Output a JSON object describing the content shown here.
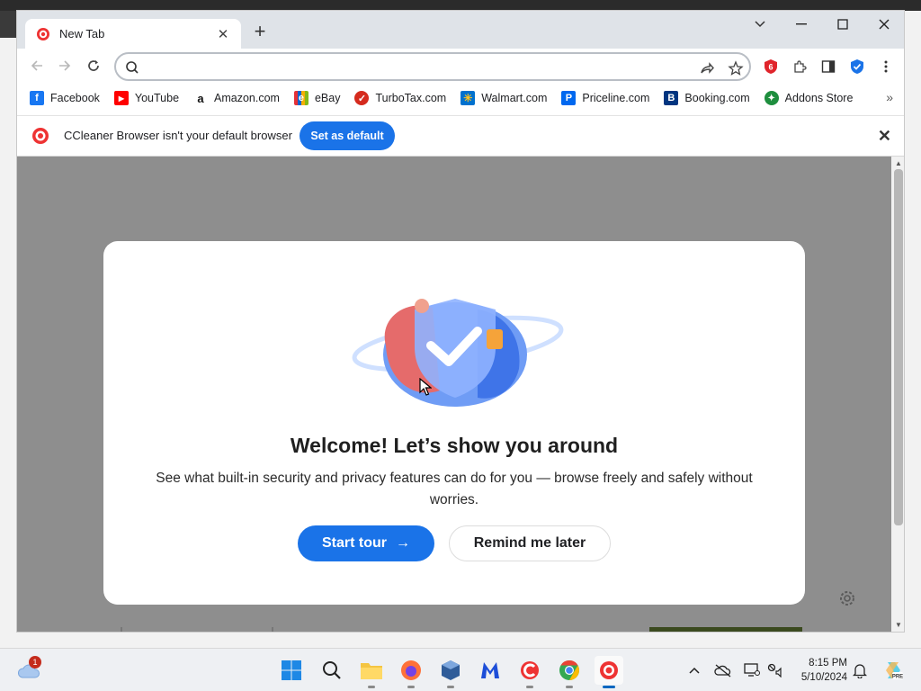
{
  "browser": {
    "tab_title": "New Tab",
    "new_tab_symbol": "+",
    "address_value": "",
    "bookmarks": [
      {
        "label": "Facebook",
        "icon": "facebook-icon",
        "color": "#1877f2",
        "glyph": "f"
      },
      {
        "label": "YouTube",
        "icon": "youtube-icon",
        "color": "#ff0000",
        "glyph": "▶"
      },
      {
        "label": "Amazon.com",
        "icon": "amazon-icon",
        "color": "#232f3e",
        "glyph": "a"
      },
      {
        "label": "eBay",
        "icon": "ebay-icon",
        "color": "#e53238",
        "glyph": "e"
      },
      {
        "label": "TurboTax.com",
        "icon": "turbotax-icon",
        "color": "#d52b1e",
        "glyph": "✓"
      },
      {
        "label": "Walmart.com",
        "icon": "walmart-icon",
        "color": "#0071ce",
        "glyph": "✳"
      },
      {
        "label": "Priceline.com",
        "icon": "priceline-icon",
        "color": "#0068ef",
        "glyph": "P"
      },
      {
        "label": "Booking.com",
        "icon": "booking-icon",
        "color": "#003580",
        "glyph": "B"
      },
      {
        "label": "Addons Store",
        "icon": "addons-store-icon",
        "color": "#1e8e3e",
        "glyph": "✦"
      }
    ],
    "infobar": {
      "text": "CCleaner Browser isn't your default browser",
      "button": "Set as default"
    }
  },
  "modal": {
    "title": "Welcome! Let’s show you around",
    "description": "See what built-in security and privacy features can do for you — browse freely and safely without worries.",
    "start_button": "Start tour",
    "start_arrow": "→",
    "remind_button": "Remind me later"
  },
  "taskbar": {
    "weather_badge": "1",
    "time": "8:15 PM",
    "date": "5/10/2024",
    "apps": [
      "start-icon",
      "search-icon",
      "file-explorer-icon",
      "firefox-icon",
      "virtualbox-icon",
      "malwarebytes-icon",
      "ccleaner-icon",
      "chrome-icon",
      "ccleaner-browser-icon"
    ]
  },
  "colors": {
    "accent": "#1a73e8",
    "page_overlay": "#8e8e8e",
    "titlebar": "#dfe3e8"
  }
}
